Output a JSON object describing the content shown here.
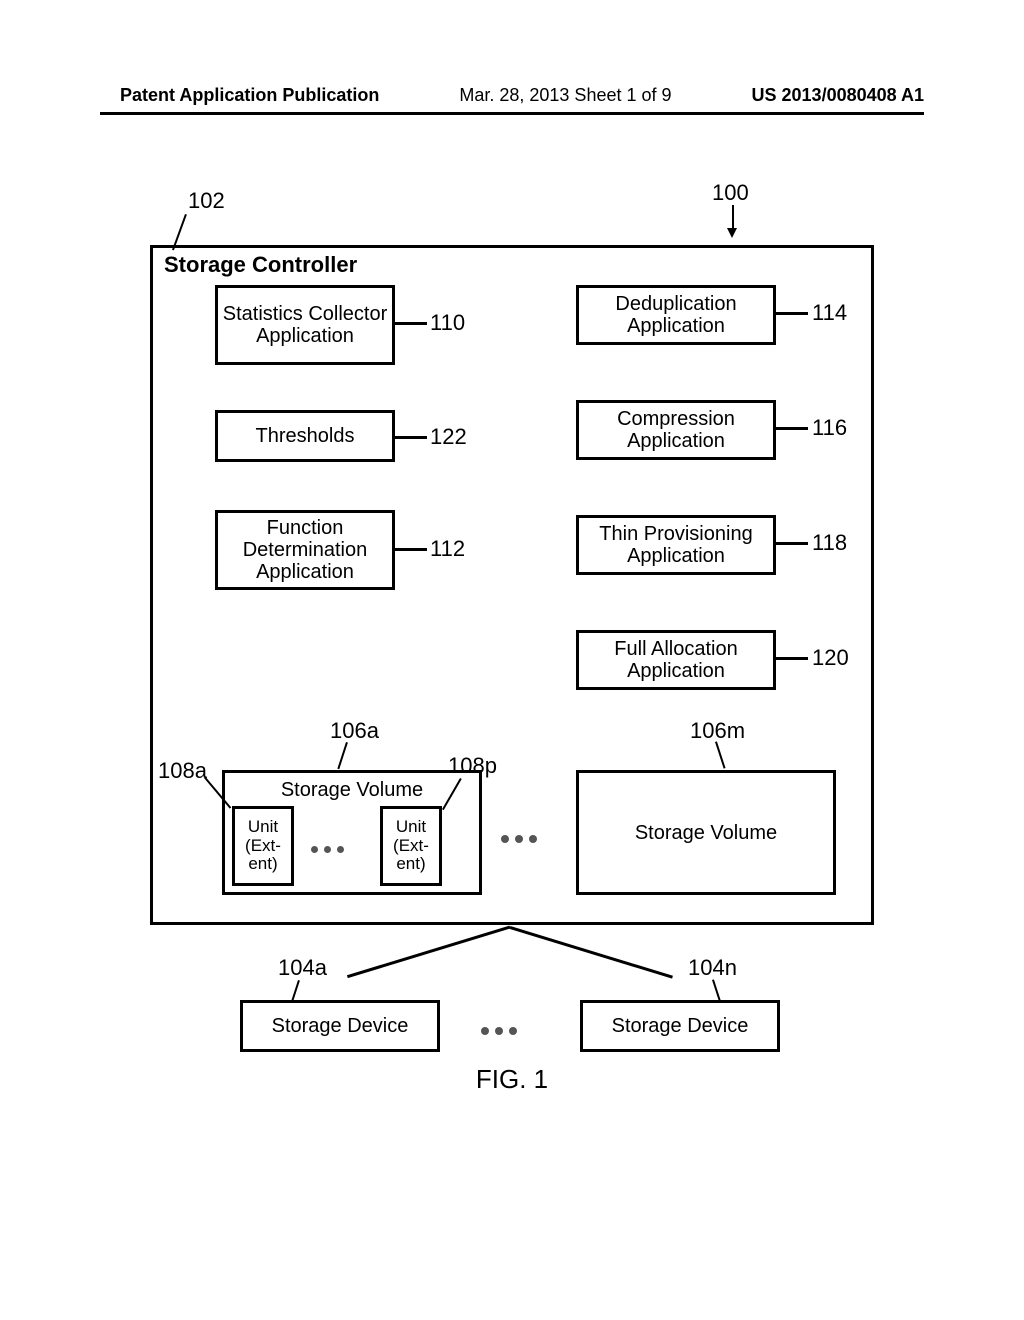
{
  "header": {
    "left": "Patent Application Publication",
    "center": "Mar. 28, 2013  Sheet 1 of 9",
    "right": "US 2013/0080408 A1"
  },
  "refs": {
    "r100": "100",
    "r102": "102",
    "r104a": "104a",
    "r104n": "104n",
    "r106a": "106a",
    "r106m": "106m",
    "r108a": "108a",
    "r108p": "108p",
    "r110": "110",
    "r112": "112",
    "r114": "114",
    "r116": "116",
    "r118": "118",
    "r120": "120",
    "r122": "122"
  },
  "labels": {
    "controller": "Storage Controller",
    "stats": "Statistics Collector Application",
    "thresholds": "Thresholds",
    "funcdet": "Function Determination Application",
    "dedup": "Deduplication Application",
    "compress": "Compression Application",
    "thinprov": "Thin Provisioning Application",
    "fullalloc": "Full Allocation Application",
    "storvol": "Storage Volume",
    "unit": "Unit (Ext-ent)",
    "stordev": "Storage Device"
  },
  "figure_caption": "FIG. 1"
}
